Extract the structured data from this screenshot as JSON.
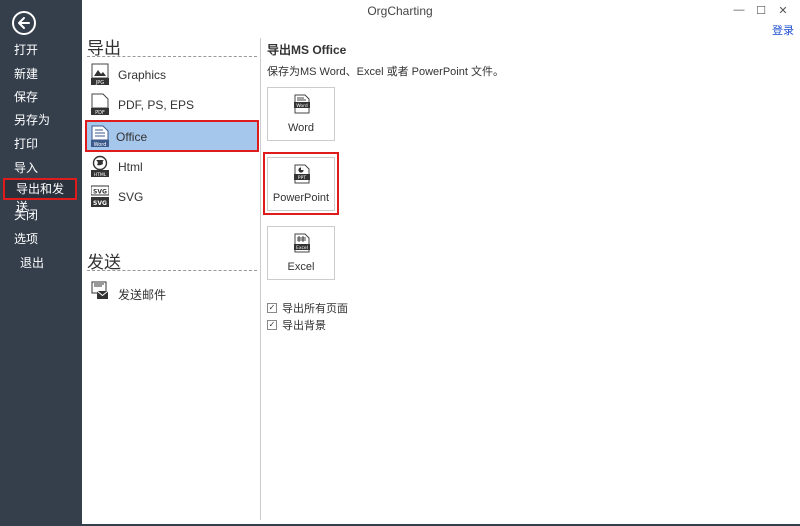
{
  "window": {
    "title": "OrgCharting",
    "login_label": "登录",
    "min_glyph": "—",
    "max_glyph": "☐",
    "close_glyph": "✕"
  },
  "sidebar": {
    "back_icon": "arrow-left-circle-icon",
    "items": [
      {
        "label": "打开"
      },
      {
        "label": "新建"
      },
      {
        "label": "保存"
      },
      {
        "label": "另存为"
      },
      {
        "label": "打印"
      },
      {
        "label": "导入"
      },
      {
        "label": "导出和发送"
      },
      {
        "label": "关闭"
      },
      {
        "label": "选项"
      },
      {
        "label": "退出"
      }
    ]
  },
  "export": {
    "title": "导出",
    "items": [
      {
        "label": "Graphics",
        "icon": "JPG"
      },
      {
        "label": "PDF, PS, EPS",
        "icon": "PDF"
      },
      {
        "label": "Office",
        "icon": "Word"
      },
      {
        "label": "Html",
        "icon": "HTML"
      },
      {
        "label": "SVG",
        "icon": "SVG"
      }
    ]
  },
  "send": {
    "title": "发送",
    "items": [
      {
        "label": "发送邮件",
        "icon": "mail-icon"
      }
    ]
  },
  "office": {
    "title": "导出MS Office",
    "description": "保存为MS Word、Excel 或者 PowerPoint 文件。",
    "options": [
      {
        "label": "Word",
        "tag": "Word"
      },
      {
        "label": "PowerPoint",
        "tag": "PPT"
      },
      {
        "label": "Excel",
        "tag": "Excel"
      }
    ],
    "checkboxes": [
      {
        "label": "导出所有页面",
        "checked": true
      },
      {
        "label": "导出背景",
        "checked": true
      }
    ]
  },
  "colors": {
    "sidebar": "#353f4c",
    "selected": "#a6c7ec",
    "highlight": "#e01b1b"
  }
}
